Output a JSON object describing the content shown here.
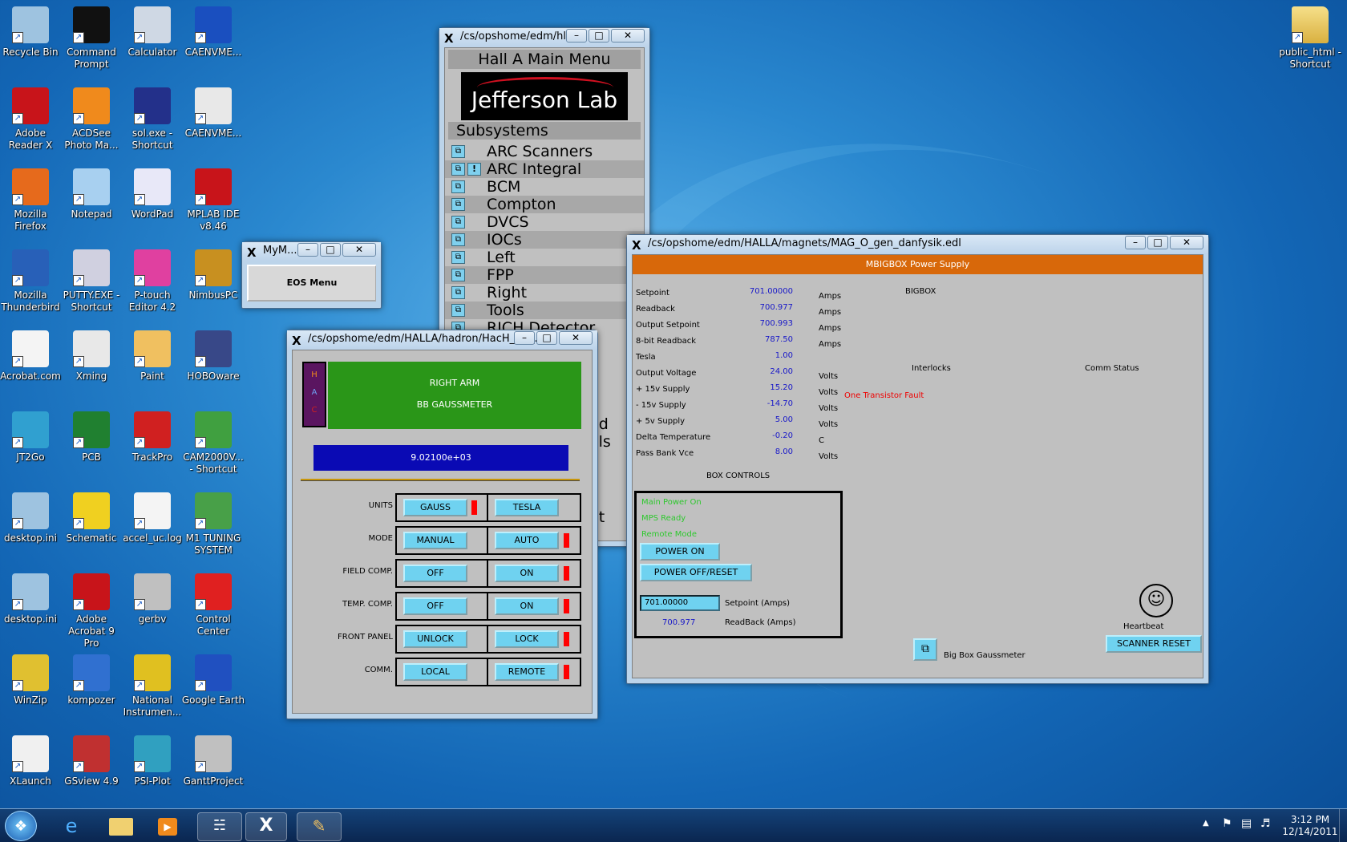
{
  "desktop": {
    "icons": [
      {
        "label": "Recycle Bin",
        "icon": "recycle-bin-icon",
        "color": "#9ec3e0"
      },
      {
        "label": "Command Prompt",
        "icon": "command-prompt-icon",
        "color": "#111111"
      },
      {
        "label": "Calculator",
        "icon": "calculator-icon",
        "color": "#cfd8e4"
      },
      {
        "label": "CAENVME...",
        "icon": "caen-icon",
        "color": "#1a4fbf"
      },
      {
        "label": "Adobe Reader X",
        "icon": "adobe-reader-icon",
        "color": "#c8141a"
      },
      {
        "label": "ACDSee Photo Ma...",
        "icon": "acdsee-icon",
        "color": "#f08a1c"
      },
      {
        "label": "sol.exe - Shortcut",
        "icon": "solitaire-icon",
        "color": "#23308a"
      },
      {
        "label": "CAENVME...",
        "icon": "caen-window-icon",
        "color": "#e8e8e8"
      },
      {
        "label": "Mozilla Firefox",
        "icon": "firefox-icon",
        "color": "#e66a1c"
      },
      {
        "label": "Notepad",
        "icon": "notepad-icon",
        "color": "#a8d0f0"
      },
      {
        "label": "WordPad",
        "icon": "wordpad-icon",
        "color": "#e8e8f8"
      },
      {
        "label": "MPLAB IDE v8.46",
        "icon": "mplab-icon",
        "color": "#c8141a"
      },
      {
        "label": "Mozilla Thunderbird",
        "icon": "thunderbird-icon",
        "color": "#2860b8"
      },
      {
        "label": "PUTTY.EXE - Shortcut",
        "icon": "putty-icon",
        "color": "#d0d0e0"
      },
      {
        "label": "P-touch Editor 4.2",
        "icon": "ptouch-icon",
        "color": "#e040a0"
      },
      {
        "label": "NimbusPC",
        "icon": "nimbus-icon",
        "color": "#c89020"
      },
      {
        "label": "Acrobat.com",
        "icon": "acrobat-com-icon",
        "color": "#f4f4f4"
      },
      {
        "label": "Xming",
        "icon": "xming-icon",
        "color": "#e8e8e8"
      },
      {
        "label": "Paint",
        "icon": "paint-icon",
        "color": "#f0c060"
      },
      {
        "label": "HOBOware",
        "icon": "hoboware-icon",
        "color": "#384888"
      },
      {
        "label": "JT2Go",
        "icon": "jt2go-icon",
        "color": "#30a0d0"
      },
      {
        "label": "PCB",
        "icon": "pcb-icon",
        "color": "#208030"
      },
      {
        "label": "TrackPro",
        "icon": "trackpro-icon",
        "color": "#d02020"
      },
      {
        "label": "CAM2000V... - Shortcut",
        "icon": "cam2000-icon",
        "color": "#40a040"
      },
      {
        "label": "desktop.ini",
        "icon": "settings-file-icon",
        "color": "#9ec3e0"
      },
      {
        "label": "Schematic",
        "icon": "schematic-icon",
        "color": "#f0d020"
      },
      {
        "label": "accel_uc.log",
        "icon": "text-file-icon",
        "color": "#f4f4f4"
      },
      {
        "label": "M1 TUNING SYSTEM",
        "icon": "m1-tuning-icon",
        "color": "#48a048"
      },
      {
        "label": "desktop.ini",
        "icon": "settings-file-icon",
        "color": "#9ec3e0"
      },
      {
        "label": "Adobe Acrobat 9 Pro",
        "icon": "acrobat-pro-icon",
        "color": "#c8141a"
      },
      {
        "label": "gerbv",
        "icon": "gerbv-icon",
        "color": "#c0c0c0"
      },
      {
        "label": "Control Center",
        "icon": "ti-control-center-icon",
        "color": "#e02020"
      },
      {
        "label": "WinZip",
        "icon": "winzip-icon",
        "color": "#e0c030"
      },
      {
        "label": "kompozer",
        "icon": "kompozer-icon",
        "color": "#3070d0"
      },
      {
        "label": "National Instrumen...",
        "icon": "labview-icon",
        "color": "#e0c020"
      },
      {
        "label": "Google Earth",
        "icon": "google-earth-icon",
        "color": "#2050c0"
      },
      {
        "label": "XLaunch",
        "icon": "xlaunch-icon",
        "color": "#f0f0f0"
      },
      {
        "label": "GSview 4.9",
        "icon": "gsview-icon",
        "color": "#c03030"
      },
      {
        "label": "PSI-Plot",
        "icon": "psi-plot-icon",
        "color": "#30a0c0"
      },
      {
        "label": "GanttProject",
        "icon": "ganttproject-icon",
        "color": "#c0c0c0"
      }
    ],
    "public_icon": {
      "label": "public_html - Shortcut",
      "icon": "folder-icon"
    }
  },
  "mym": {
    "title": "MyM...",
    "button": "EOS Menu"
  },
  "hallmenu": {
    "title": "/cs/opshome/edm/hl...",
    "header": "Hall A Main Menu",
    "logo": "Jefferson Lab",
    "subsystems": "Subsystems",
    "items": [
      "ARC Scanners",
      "ARC Integral",
      "BCM",
      "Compton",
      "DVCS",
      "IOCs",
      "Left",
      "FPP",
      "Right",
      "Tools",
      "RICH Detector"
    ],
    "hidden": [
      "ed",
      "ols",
      "et"
    ]
  },
  "gauss": {
    "title": "/cs/opshome/edm/HALLA/hadron/HacH_BB_...",
    "hac": [
      "H",
      "A",
      "C"
    ],
    "arm": "RIGHT ARM",
    "device": "BB GAUSSMETER",
    "reading": "9.02100e+03",
    "rows": [
      {
        "label": "UNITS",
        "left": "GAUSS",
        "right": "TESLA",
        "ind": "left"
      },
      {
        "label": "MODE",
        "left": "MANUAL",
        "right": "AUTO",
        "ind": "right"
      },
      {
        "label": "FIELD COMP.",
        "left": "OFF",
        "right": "ON",
        "ind": "right"
      },
      {
        "label": "TEMP. COMP.",
        "left": "OFF",
        "right": "ON",
        "ind": "right"
      },
      {
        "label": "FRONT PANEL",
        "left": "UNLOCK",
        "right": "LOCK",
        "ind": "right"
      },
      {
        "label": "COMM.",
        "left": "LOCAL",
        "right": "REMOTE",
        "ind": "right"
      }
    ]
  },
  "ps": {
    "title": "/cs/opshome/edm/HALLA/magnets/MAG_O_gen_danfysik.edl",
    "header": "MBIGBOX Power Supply",
    "bigbox": "BIGBOX",
    "readings": [
      {
        "label": "Setpoint",
        "value": "701.00000",
        "unit": "Amps"
      },
      {
        "label": "Readback",
        "value": "700.977",
        "unit": "Amps"
      },
      {
        "label": "Output Setpoint",
        "value": "700.993",
        "unit": "Amps"
      },
      {
        "label": "8-bit Readback",
        "value": "787.50",
        "unit": "Amps"
      },
      {
        "label": "Tesla",
        "value": "1.00",
        "unit": ""
      },
      {
        "label": "Output Voltage",
        "value": "24.00",
        "unit": "Volts"
      },
      {
        "label": "+ 15v Supply",
        "value": "15.20",
        "unit": "Volts"
      },
      {
        "label": "- 15v Supply",
        "value": "-14.70",
        "unit": "Volts"
      },
      {
        "label": "+ 5v Supply",
        "value": "5.00",
        "unit": "Volts"
      },
      {
        "label": "Delta Temperature",
        "value": "-0.20",
        "unit": "C"
      },
      {
        "label": "Pass Bank Vce",
        "value": "8.00",
        "unit": "Volts"
      }
    ],
    "interlocks": "Interlocks",
    "fault": "One Transistor Fault",
    "comm": "Comm Status",
    "box_controls": "BOX CONTROLS",
    "status": [
      "Main Power On",
      "MPS Ready",
      "Remote Mode"
    ],
    "power_on": "POWER ON",
    "power_off": "POWER OFF/RESET",
    "setpoint_value": "701.00000",
    "setpoint_label": "Setpoint (Amps)",
    "readback_value": "700.977",
    "readback_label": "ReadBack (Amps)",
    "gaussmeter": "Big Box Gaussmeter",
    "heartbeat": "Heartbeat",
    "scanner_reset": "SCANNER RESET"
  },
  "taskbar": {
    "time": "3:12 PM",
    "date": "12/14/2011"
  }
}
